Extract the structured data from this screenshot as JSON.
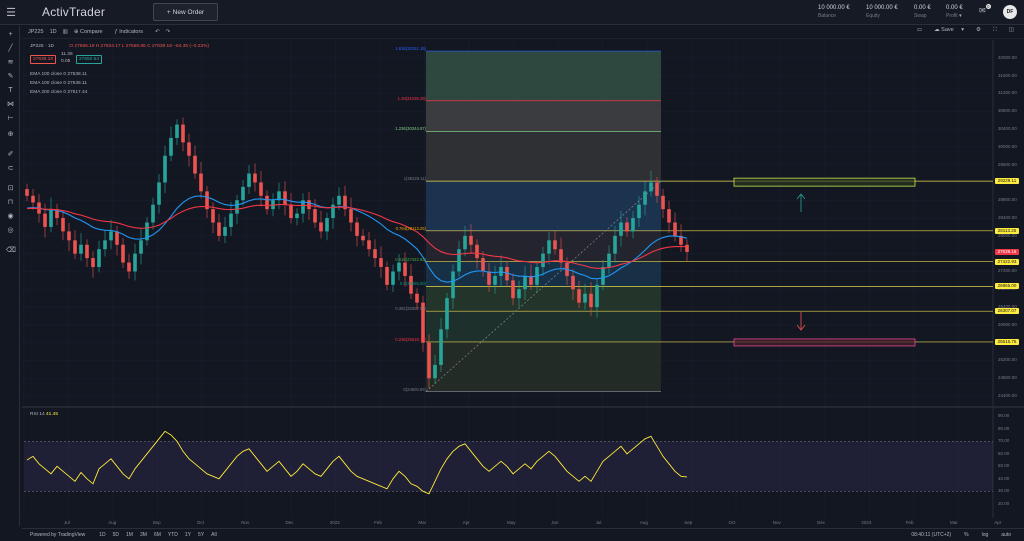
{
  "app": {
    "logo": "ActivTrader",
    "new_order": "New Order"
  },
  "account": [
    {
      "value": "10 000.00 €",
      "label": "Balance"
    },
    {
      "value": "10 000.00 €",
      "label": "Equity"
    },
    {
      "value": "0.00 €",
      "label": "Swap"
    },
    {
      "value": "0.00 €",
      "label": "Profit"
    }
  ],
  "notifications": "0",
  "user_initials": "DF",
  "toolbar": {
    "symbol": "JP225",
    "interval": "1D",
    "compare": "Compare",
    "indicators": "Indicators",
    "save": "Save"
  },
  "ohlc": "O 27696.19  H 27824.17  L 27568.86  C 27639.18  −64.35 (−0.23%)",
  "price_boxes": {
    "sell": "27639.18",
    "spread": "11.36",
    "spread2": "0.05",
    "buy": "27650.54"
  },
  "ema_legend": [
    {
      "text": "EMA 100 close 0  27538.11",
      "color": "#2962ff"
    },
    {
      "text": "EMA 100 close 0  27538.11",
      "color": "#2196f3"
    },
    {
      "text": "EMA 200 close 0  27517.44",
      "color": "#f23645"
    }
  ],
  "rsi_legend": {
    "label": "RSI 14",
    "value": "41.45"
  },
  "fib_levels": [
    {
      "label": "1.618(32151.15)",
      "price": 32151.15,
      "color": "#2962ff"
    },
    {
      "label": "1.28(31035.29)",
      "price": 31035.29,
      "color": "#f23645"
    },
    {
      "label": "1.236(30344.97)",
      "price": 30344.97,
      "color": "#81c784"
    },
    {
      "label": "1(29229.11)",
      "price": 29229.11,
      "color": "#787b86"
    },
    {
      "label": "0.764(28113.25)",
      "price": 28113.25,
      "color": "#f7a600"
    },
    {
      "label": "0.618(27422.93)",
      "price": 27422.93,
      "color": "#4caf50"
    },
    {
      "label": "0.5(26865.00)",
      "price": 26865.0,
      "color": "#089981"
    },
    {
      "label": "0.382(26307.07)",
      "price": 26307.07,
      "color": "#787b86"
    },
    {
      "label": "0.236(25616.75)",
      "price": 25616.75,
      "color": "#f23645"
    },
    {
      "label": "0(24500.89)",
      "price": 24500.89,
      "color": "#787b86"
    }
  ],
  "price_tags": [
    {
      "text": "29229.11",
      "price": 29229.11,
      "bg": "#ffeb3b",
      "fg": "#131722"
    },
    {
      "text": "28113.25",
      "price": 28113.25,
      "bg": "#ffeb3b",
      "fg": "#131722"
    },
    {
      "text": "27639.18",
      "price": 27639.18,
      "bg": "#f23645",
      "fg": "#ffffff"
    },
    {
      "text": "27422.93",
      "price": 27422.93,
      "bg": "#ffeb3b",
      "fg": "#131722"
    },
    {
      "text": "26865.00",
      "price": 26865.0,
      "bg": "#ffeb3b",
      "fg": "#131722"
    },
    {
      "text": "26307.07",
      "price": 26307.07,
      "bg": "#ffeb3b",
      "fg": "#131722"
    },
    {
      "text": "25616.75",
      "price": 25616.75,
      "bg": "#ffeb3b",
      "fg": "#131722"
    }
  ],
  "price_axis": [
    "32000.00",
    "31600.00",
    "31200.00",
    "30800.00",
    "30400.00",
    "30000.00",
    "29600.00",
    "29200.00",
    "28800.00",
    "28400.00",
    "28000.00",
    "27600.00",
    "27200.00",
    "26800.00",
    "26400.00",
    "26000.00",
    "25600.00",
    "25200.00",
    "24800.00",
    "24400.00"
  ],
  "rsi_axis": [
    "90.00",
    "80.00",
    "70.00",
    "60.00",
    "50.00",
    "40.00",
    "30.00",
    "20.00"
  ],
  "time_axis": [
    "Jul",
    "Aug",
    "Sep",
    "Oct",
    "Nov",
    "Dec",
    "2022",
    "Feb",
    "Mar",
    "Apr",
    "May",
    "Jun",
    "Jul",
    "Aug",
    "Sep",
    "Oct",
    "Nov",
    "Dec",
    "2023",
    "Feb",
    "Mar",
    "Apr"
  ],
  "bottom": {
    "powered": "Powered by TradingView",
    "ranges": [
      "1D",
      "5D",
      "1M",
      "3M",
      "6M",
      "YTD",
      "1Y",
      "5Y",
      "All"
    ],
    "time": "08:40:11 (UTC+2)",
    "pct": "%",
    "log": "log",
    "auto": "auto"
  },
  "colors": {
    "up": "#26a69a",
    "down": "#ef5350",
    "ema_blue": "#2196f3",
    "ema_red": "#f23645",
    "rsi": "#ffeb3b"
  },
  "chart_data": {
    "type": "candlestick",
    "symbol": "JP225",
    "interval": "1D",
    "ylim": [
      24200,
      32400
    ],
    "candles_close": [
      28900,
      28750,
      28500,
      28200,
      28600,
      28400,
      28100,
      27900,
      27600,
      27800,
      27500,
      27300,
      27700,
      27900,
      28100,
      27800,
      27400,
      27200,
      27600,
      27900,
      28300,
      28700,
      29200,
      29800,
      30200,
      30500,
      30100,
      29800,
      29400,
      29000,
      28600,
      28300,
      28000,
      28200,
      28500,
      28800,
      29100,
      29400,
      29200,
      28900,
      28600,
      28800,
      29000,
      28700,
      28400,
      28500,
      28800,
      28600,
      28300,
      28100,
      28400,
      28700,
      28900,
      28600,
      28300,
      28000,
      27900,
      27700,
      27500,
      27300,
      26900,
      27200,
      27400,
      27100,
      26700,
      26500,
      25600,
      24800,
      25100,
      25900,
      26600,
      27200,
      27700,
      28000,
      27800,
      27500,
      27200,
      26900,
      27100,
      27300,
      27000,
      26600,
      26800,
      27100,
      26900,
      27300,
      27600,
      27900,
      27700,
      27400,
      27100,
      26800,
      26500,
      26700,
      26400,
      26900,
      27300,
      27600,
      28000,
      28300,
      28100,
      28400,
      28700,
      29000,
      29200,
      28900,
      28600,
      28300,
      28000,
      27800,
      27639
    ],
    "rsi_values": [
      55,
      58,
      52,
      48,
      44,
      50,
      46,
      42,
      38,
      45,
      40,
      36,
      48,
      52,
      56,
      50,
      44,
      40,
      48,
      54,
      60,
      66,
      72,
      78,
      75,
      70,
      62,
      56,
      52,
      48,
      44,
      42,
      40,
      46,
      52,
      58,
      62,
      64,
      58,
      52,
      46,
      50,
      54,
      48,
      42,
      46,
      52,
      48,
      44,
      42,
      48,
      54,
      58,
      52,
      46,
      42,
      40,
      38,
      36,
      34,
      32,
      40,
      46,
      42,
      36,
      34,
      30,
      28,
      38,
      48,
      56,
      62,
      66,
      68,
      62,
      56,
      50,
      46,
      50,
      54,
      50,
      44,
      48,
      52,
      48,
      54,
      58,
      62,
      58,
      52,
      46,
      42,
      38,
      42,
      38,
      46,
      54,
      58,
      62,
      66,
      60,
      64,
      68,
      72,
      74,
      66,
      58,
      52,
      46,
      42,
      41.45
    ]
  }
}
